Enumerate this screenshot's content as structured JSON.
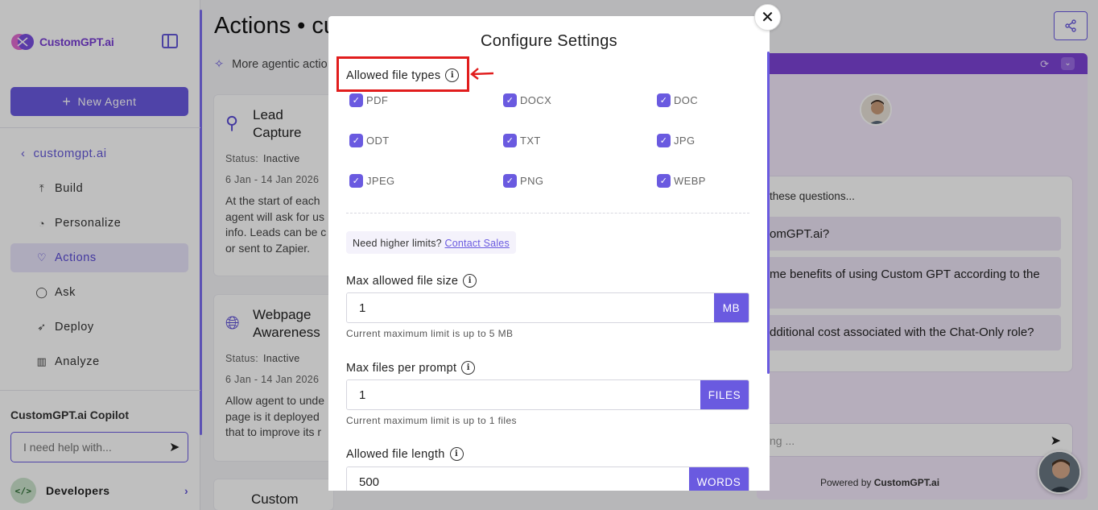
{
  "sidebar": {
    "logo_text": "CustomGPT.ai",
    "new_agent_label": "New Agent",
    "back_label": "customgpt.ai",
    "nav": [
      {
        "label": "Build",
        "icon": "build-icon"
      },
      {
        "label": "Personalize",
        "icon": "palette-icon"
      },
      {
        "label": "Actions",
        "icon": "actions-icon"
      },
      {
        "label": "Ask",
        "icon": "chat-icon"
      },
      {
        "label": "Deploy",
        "icon": "rocket-icon"
      },
      {
        "label": "Analyze",
        "icon": "chart-icon"
      }
    ],
    "active_nav": "Actions",
    "copilot_title": "CustomGPT.ai Copilot",
    "copilot_placeholder": "I need help with...",
    "developers_label": "Developers"
  },
  "main": {
    "title": "Actions • cu",
    "subtitle": "More agentic actio",
    "cards": [
      {
        "name_line1": "Lead",
        "name_line2": "Capture",
        "status_label": "Status:",
        "status_value": "Inactive",
        "date": "6 Jan - 14 Jan 2026",
        "desc": [
          "At the start of each",
          "agent will ask for us",
          "info. Leads can be c",
          "or sent to Zapier."
        ]
      },
      {
        "name_line1": "Webpage",
        "name_line2": "Awareness",
        "status_label": "Status:",
        "status_value": "Inactive",
        "date": "6 Jan - 14 Jan 2026",
        "desc": [
          "Allow agent to unde",
          "page is it deployed",
          "that to improve its r"
        ]
      },
      {
        "name_line1": "Custom",
        "name_line2": ""
      }
    ]
  },
  "preview": {
    "intro": "these questions...",
    "questions": [
      "omGPT.ai?",
      "me benefits of using Custom GPT according to the",
      "dditional cost associated with the Chat-Only role?"
    ],
    "input_placeholder": "ng ...",
    "powered_prefix": "Powered by",
    "powered_brand": "CustomGPT.ai"
  },
  "modal": {
    "title": "Configure Settings",
    "allowed_types_label": "Allowed file types",
    "file_types": [
      "PDF",
      "DOCX",
      "DOC",
      "ODT",
      "TXT",
      "JPG",
      "JPEG",
      "PNG",
      "WEBP"
    ],
    "limits_text": "Need higher limits?",
    "limits_link": "Contact Sales",
    "max_size_label": "Max allowed file size",
    "max_size_value": "1",
    "max_size_unit": "MB",
    "max_size_hint": "Current maximum limit is up to 5 MB",
    "max_files_label": "Max files per prompt",
    "max_files_value": "1",
    "max_files_unit": "FILES",
    "max_files_hint": "Current maximum limit is up to 1 files",
    "file_length_label": "Allowed file length",
    "file_length_value": "500",
    "file_length_unit": "WORDS"
  },
  "colors": {
    "accent": "#6a5ae0",
    "highlight": "#e11d1d",
    "preview_bar": "#7c43d6"
  }
}
